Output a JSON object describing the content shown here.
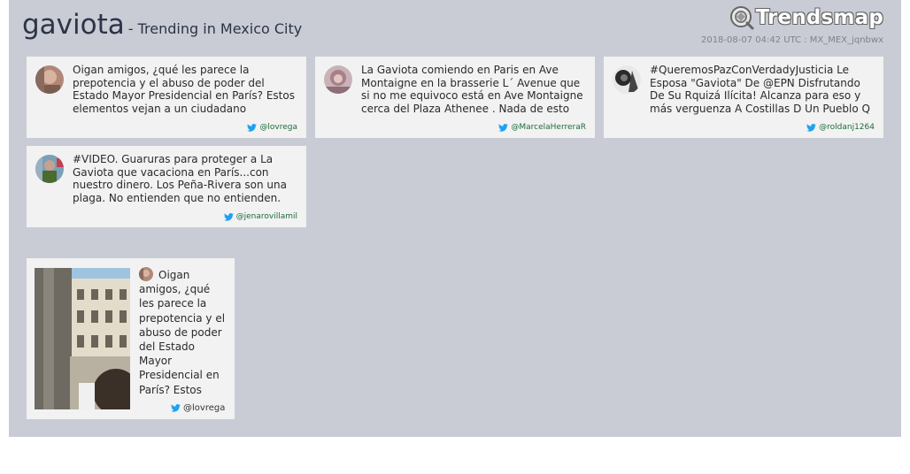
{
  "header": {
    "topic": "gaviota",
    "subtitle": "- Trending in Mexico City",
    "brand": "Trendsmap",
    "meta": "2018-08-07 04:42 UTC : MX_MEX_jqnbwx"
  },
  "tweets": [
    {
      "text": "Oigan amigos, ¿qué les parece la prepotencia y el abuso de poder del Estado Mayor Presidencial en París? Estos elementos vejan a un ciudadano",
      "handle": "@lovrega"
    },
    {
      "text": "La Gaviota comiendo en Paris en Ave Montaigne en la brasserie L´ Avenue que si no me equivoco está en Ave Montaigne cerca del Plaza Athenee . Nada de esto",
      "handle": "@MarcelaHerreraR"
    },
    {
      "text": "#QueremosPazConVerdadyJusticia Le Esposa \"Gaviota\" De @EPN Disfrutando De Su Rquizá Ilícita! Alcanza para eso y más verguenza A Costillas D Un Pueblo Q",
      "handle": "@roldanj1264"
    },
    {
      "text": "#VIDEO. Guaruras para proteger a La Gaviota que vacaciona en París...con nuestro dinero. Los Peña-Rivera son una plaga. No entienden que no entienden. La",
      "handle": "@jenarovillamil"
    }
  ],
  "media": {
    "text": "Oigan amigos, ¿qué les parece la prepotencia y el abuso de poder del Estado Mayor Presidencial en París? Estos elementos",
    "handle": "@lovrega"
  },
  "colors": {
    "panel": "#c9ccd4",
    "card": "#f2f2f3",
    "twitter_blue": "#1da1f2",
    "handle_green": "#1e6b3a"
  }
}
